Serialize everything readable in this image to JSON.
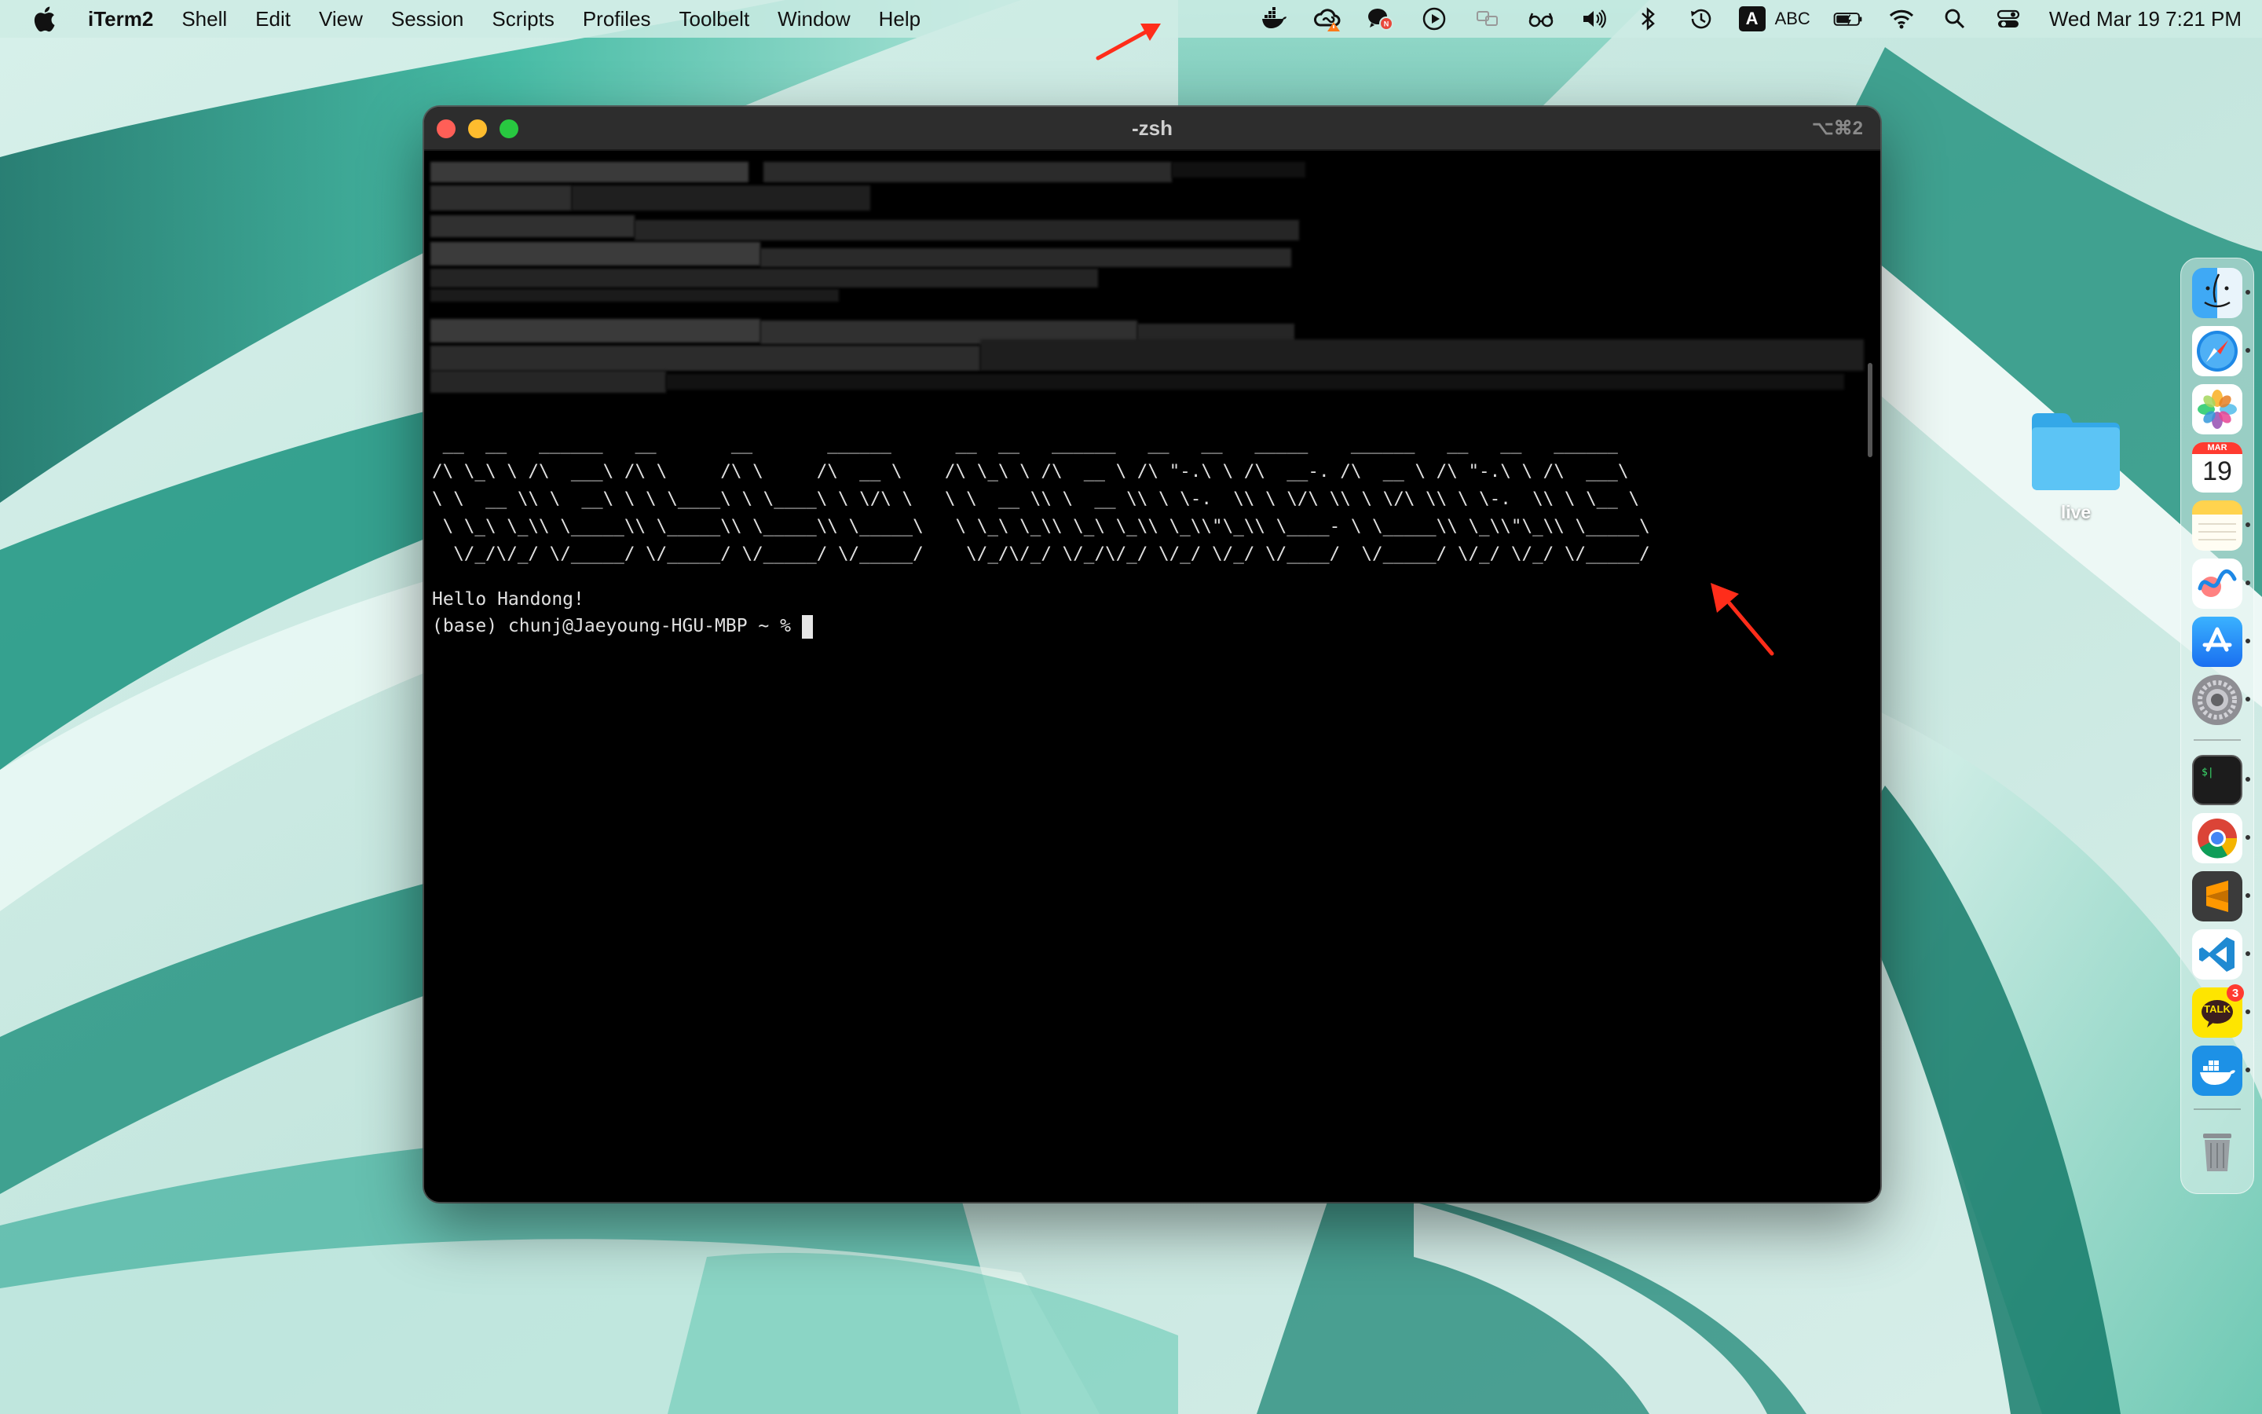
{
  "menubar": {
    "apple_icon": "apple-logo-icon",
    "items": [
      "iTerm2",
      "Shell",
      "Edit",
      "View",
      "Session",
      "Scripts",
      "Profiles",
      "Toolbelt",
      "Window",
      "Help"
    ],
    "status_icons": [
      "docker-whale-icon",
      "creative-cloud-icon",
      "wechat-icon",
      "play-circle-icon",
      "screen-mirror-icon",
      "reading-glasses-icon",
      "volume-icon",
      "bluetooth-icon",
      "time-machine-icon"
    ],
    "input_source_badge": "A",
    "input_source_name": "ABC",
    "right_icons": [
      "battery-icon",
      "wifi-icon",
      "search-icon",
      "control-center-icon"
    ],
    "clock": "Wed Mar 19  7:21 PM"
  },
  "terminal": {
    "title": "-zsh",
    "shortcut": "⌥⌘2",
    "ascii_art": [
      " __  __   ______   __       __       ______      __  __   ______   __   __   _____    ______   __   __   ______",
      "/\\ \\_\\ \\ /\\  ___\\ /\\ \\     /\\ \\     /\\  __ \\    /\\ \\_\\ \\ /\\  __ \\ /\\ \"-.\\ \\ /\\  __-. /\\  __ \\ /\\ \"-.\\ \\ /\\  ___\\",
      "\\ \\  __ \\\\ \\  __\\ \\ \\ \\____\\ \\ \\____\\ \\ \\/\\ \\   \\ \\  __ \\\\ \\  __ \\\\ \\ \\-.  \\\\ \\ \\/\\ \\\\ \\ \\/\\ \\\\ \\ \\-.  \\\\ \\ \\__ \\",
      " \\ \\_\\ \\_\\\\ \\_____\\\\ \\_____\\\\ \\_____\\\\ \\_____\\   \\ \\_\\ \\_\\\\ \\_\\ \\_\\\\ \\_\\\\\"\\_\\\\ \\____- \\ \\_____\\\\ \\_\\\\\"\\_\\\\ \\_____\\",
      "  \\/_/\\/_/ \\/_____/ \\/_____/ \\/_____/ \\/_____/    \\/_/\\/_/ \\/_/\\/_/ \\/_/ \\/_/ \\/____/  \\/_____/ \\/_/ \\/_/ \\/_____/"
    ],
    "hello": "Hello Handong!",
    "prompt": "(base) chunj@Jaeyoung-HGU-MBP ~ %"
  },
  "desktop": {
    "folder_label": "live"
  },
  "dock": {
    "apps": [
      {
        "name": "finder-icon",
        "running": true
      },
      {
        "name": "safari-icon",
        "running": true
      },
      {
        "name": "photos-icon",
        "running": false
      },
      {
        "name": "calendar-icon",
        "running": false,
        "month": "MAR",
        "day": "19"
      },
      {
        "name": "notes-icon",
        "running": true
      },
      {
        "name": "freeform-icon",
        "running": true
      },
      {
        "name": "app-store-icon",
        "running": true
      },
      {
        "name": "system-settings-icon",
        "running": true
      },
      {
        "name": "iterm2-icon",
        "running": true
      },
      {
        "name": "chrome-icon",
        "running": true
      },
      {
        "name": "sublime-text-icon",
        "running": true
      },
      {
        "name": "vscode-icon",
        "running": true
      },
      {
        "name": "kakaotalk-icon",
        "running": true,
        "badge": "3",
        "label": "TALK"
      },
      {
        "name": "docker-icon",
        "running": true
      },
      {
        "name": "trash-icon",
        "running": false
      }
    ]
  },
  "colors": {
    "menubar_bg": "#cdebe4",
    "terminal_bg": "#000000",
    "titlebar_bg": "#2d2d2d",
    "close": "#ff5f57",
    "minimize": "#febc2e",
    "zoom": "#28c840",
    "annotation_arrow": "#ff2d1a"
  }
}
